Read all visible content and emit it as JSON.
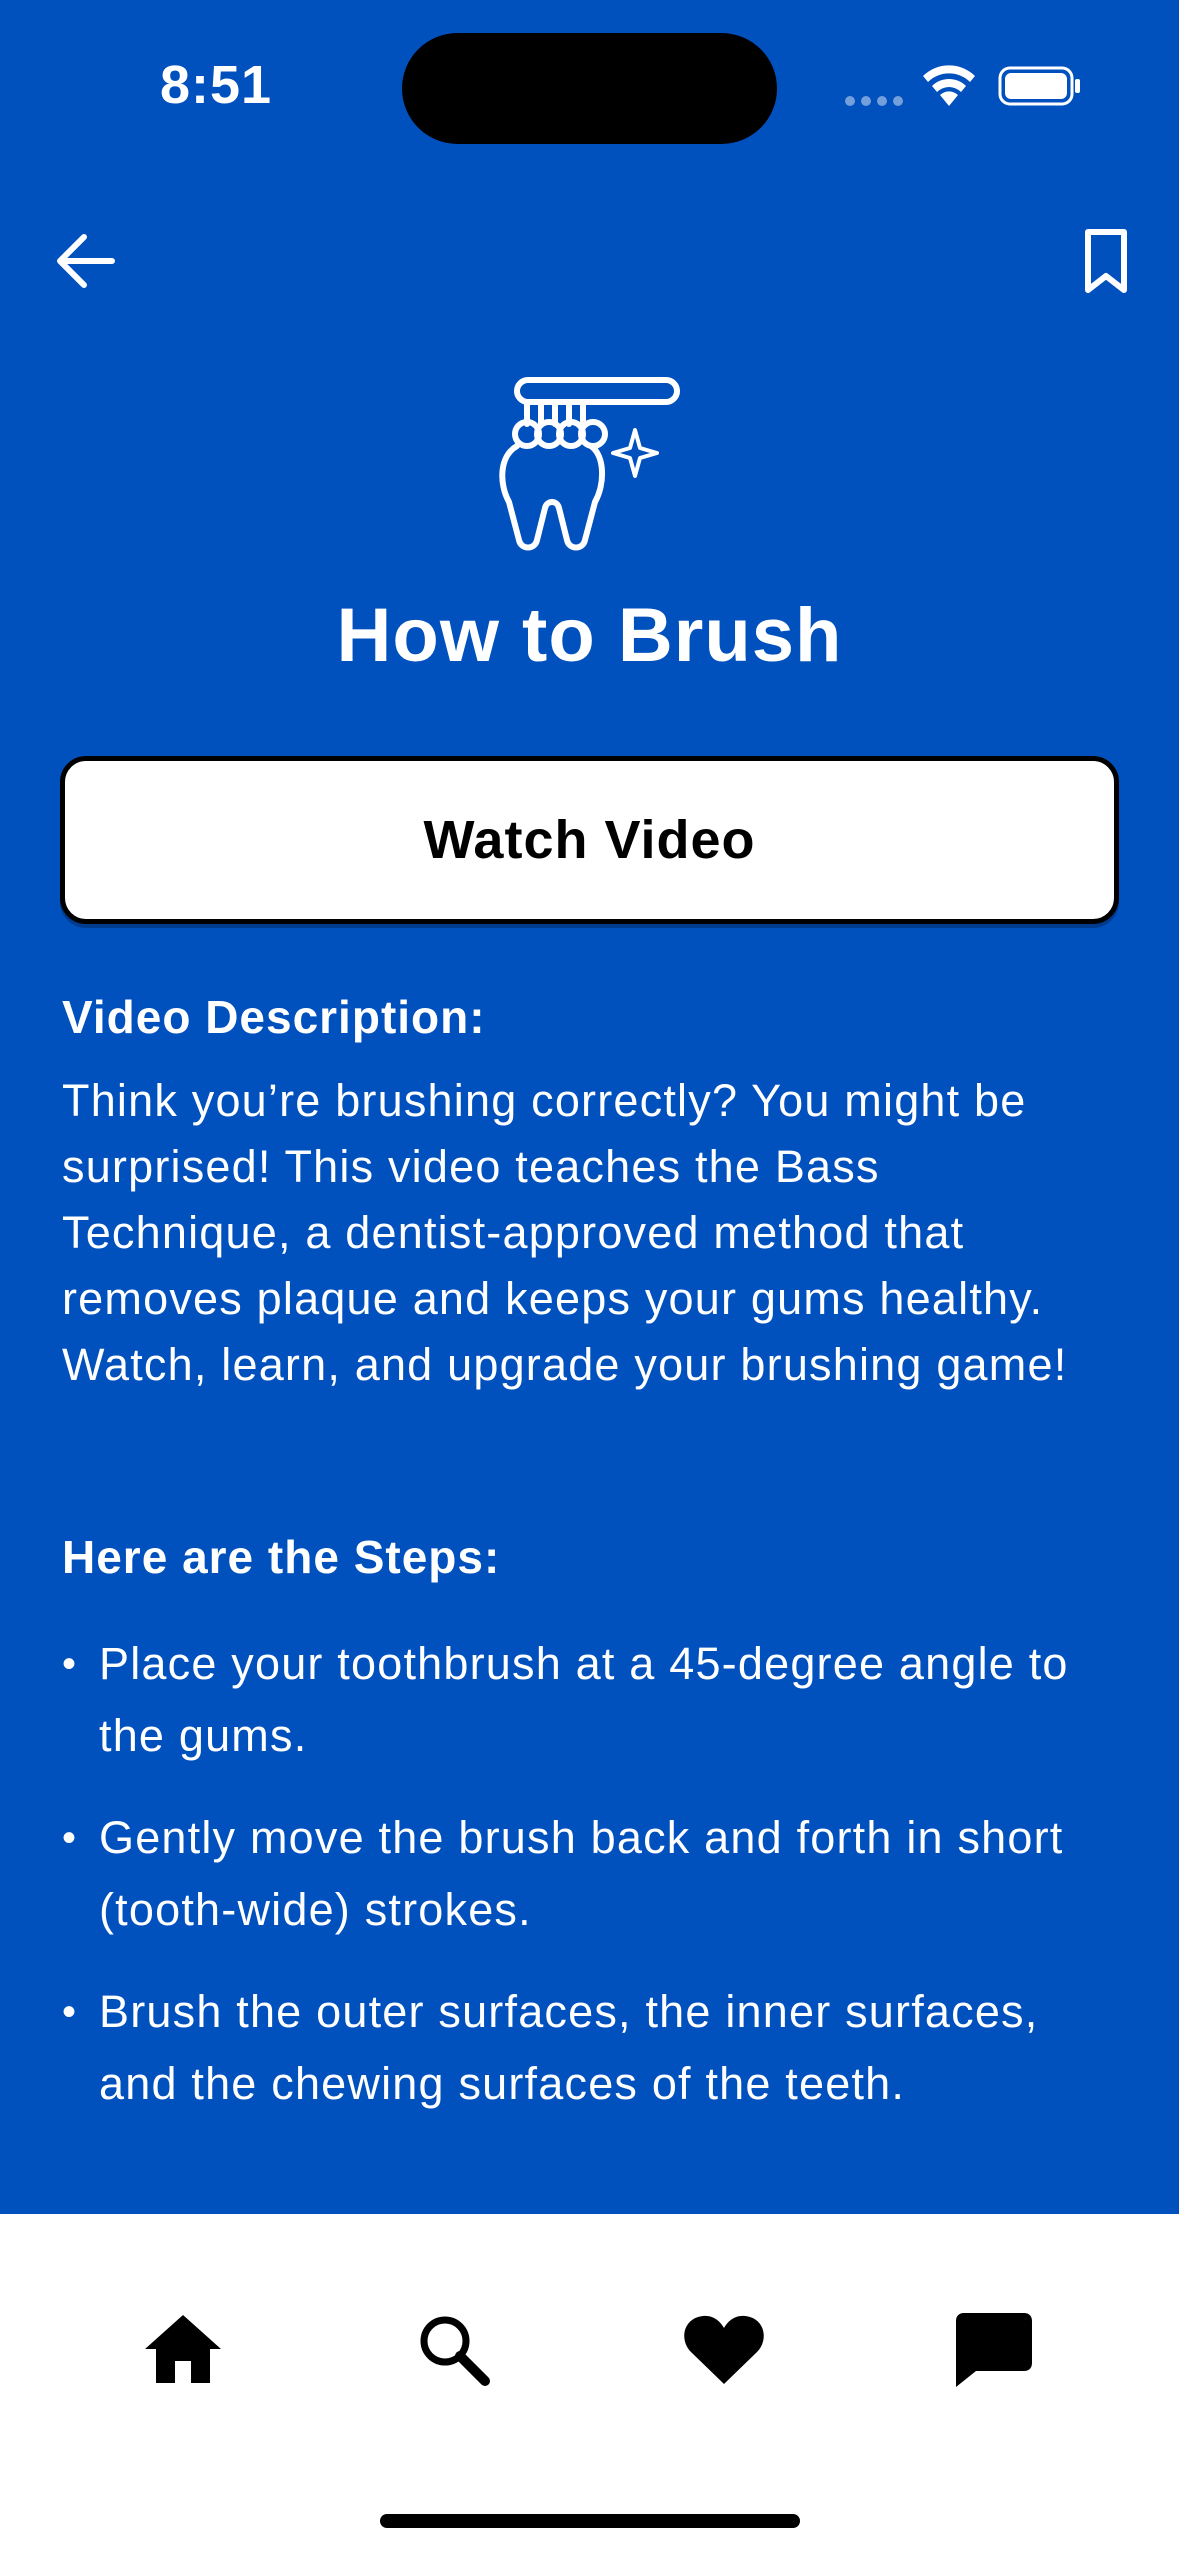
{
  "status_bar": {
    "time": "8:51"
  },
  "header": {
    "back_icon": "arrow-left-icon",
    "bookmark_icon": "bookmark-icon"
  },
  "hero": {
    "icon": "tooth-toothbrush-icon",
    "title": "How to Brush"
  },
  "watch_button": {
    "label": "Watch Video"
  },
  "description": {
    "heading": "Video Description:",
    "text": "Think you’re brushing correctly? You might be surprised! This video teaches the Bass Technique, a dentist-approved method that removes plaque and keeps your gums healthy. Watch, learn, and upgrade your brushing game!"
  },
  "steps": {
    "heading": "Here are the Steps:",
    "bullet": "•",
    "items": [
      "Place your toothbrush at a 45-degree angle to the gums.",
      "Gently move the brush back and forth in short (tooth-wide) strokes.",
      "Brush the outer surfaces, the inner surfaces, and the chewing surfaces of the teeth."
    ]
  },
  "tab_bar": {
    "tabs": [
      {
        "icon": "home-icon"
      },
      {
        "icon": "search-icon"
      },
      {
        "icon": "heart-icon"
      },
      {
        "icon": "chat-icon"
      }
    ]
  },
  "colors": {
    "background": "#0050BE",
    "tab_bar": "#FFFFFF",
    "button": "#FFFFFF",
    "text": "#FFFFFF"
  }
}
